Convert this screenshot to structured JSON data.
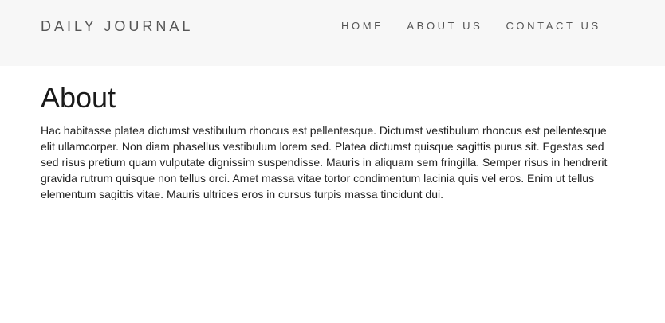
{
  "header": {
    "brand": "DAILY JOURNAL",
    "nav": [
      {
        "label": "HOME"
      },
      {
        "label": "ABOUT US"
      },
      {
        "label": "CONTACT US"
      }
    ]
  },
  "main": {
    "title": "About",
    "paragraph": "Hac habitasse platea dictumst vestibulum rhoncus est pellentesque. Dictumst vestibulum rhoncus est pellentesque elit ullamcorper. Non diam phasellus vestibulum lorem sed. Platea dictumst quisque sagittis purus sit. Egestas sed sed risus pretium quam vulputate dignissim suspendisse. Mauris in aliquam sem fringilla. Semper risus in hendrerit gravida rutrum quisque non tellus orci. Amet massa vitae tortor condimentum lacinia quis vel eros. Enim ut tellus elementum sagittis vitae. Mauris ultrices eros in cursus turpis massa tincidunt dui."
  },
  "colors": {
    "header_background": "#f7f7f7",
    "nav_text": "#555555",
    "body_text": "#222222",
    "page_background": "#ffffff"
  }
}
